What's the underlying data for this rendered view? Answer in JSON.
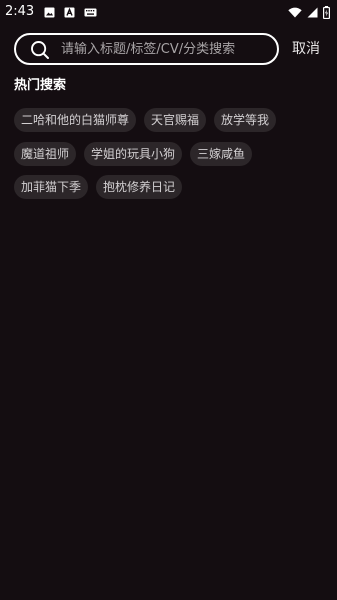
{
  "status_bar": {
    "time": "2:43",
    "left_icons": [
      "image-icon",
      "app-a-icon",
      "keyboard-icon"
    ],
    "right_icons": [
      "wifi-icon",
      "signal-icon",
      "battery-icon"
    ]
  },
  "search": {
    "placeholder": "请输入标题/标签/CV/分类搜索",
    "value": "",
    "cancel_label": "取消"
  },
  "hot_search": {
    "title": "热门搜索",
    "rows": [
      [
        "二哈和他的白猫师尊",
        "天官赐福",
        "放学等我"
      ],
      [
        "魔道祖师",
        "学姐的玩具小狗",
        "三嫁咸鱼"
      ],
      [
        "加菲猫下季",
        "抱枕修养日记"
      ]
    ]
  },
  "colors": {
    "background": "#140d11",
    "tag_background": "#2c2629",
    "tag_text": "#d3d0d2"
  }
}
